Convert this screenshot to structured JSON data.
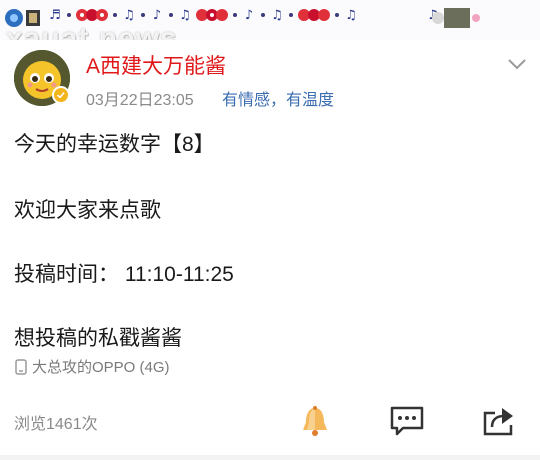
{
  "banner": {
    "watermark": "xauat news"
  },
  "post": {
    "username": "A西建大万能酱",
    "timestamp": "03月22日23:05",
    "slogan": "有情感，有温度",
    "lines": [
      "今天的幸运数字【8】",
      "欢迎大家来点歌",
      "投稿时间：  11:10-11:25",
      "想投稿的私戳酱酱"
    ],
    "device": "大总攻的OPPO (4G)",
    "views": "浏览1461次"
  },
  "icons": {
    "verified": "verified-badge-icon",
    "more": "chevron-down-icon",
    "device": "phone-icon",
    "like": "bell-like-icon",
    "comment": "comment-icon",
    "share": "share-icon"
  },
  "colors": {
    "username": "#e0181a",
    "slogan": "#3b6db1",
    "meta": "#8a8a8a",
    "verified": "#f2b51c"
  }
}
